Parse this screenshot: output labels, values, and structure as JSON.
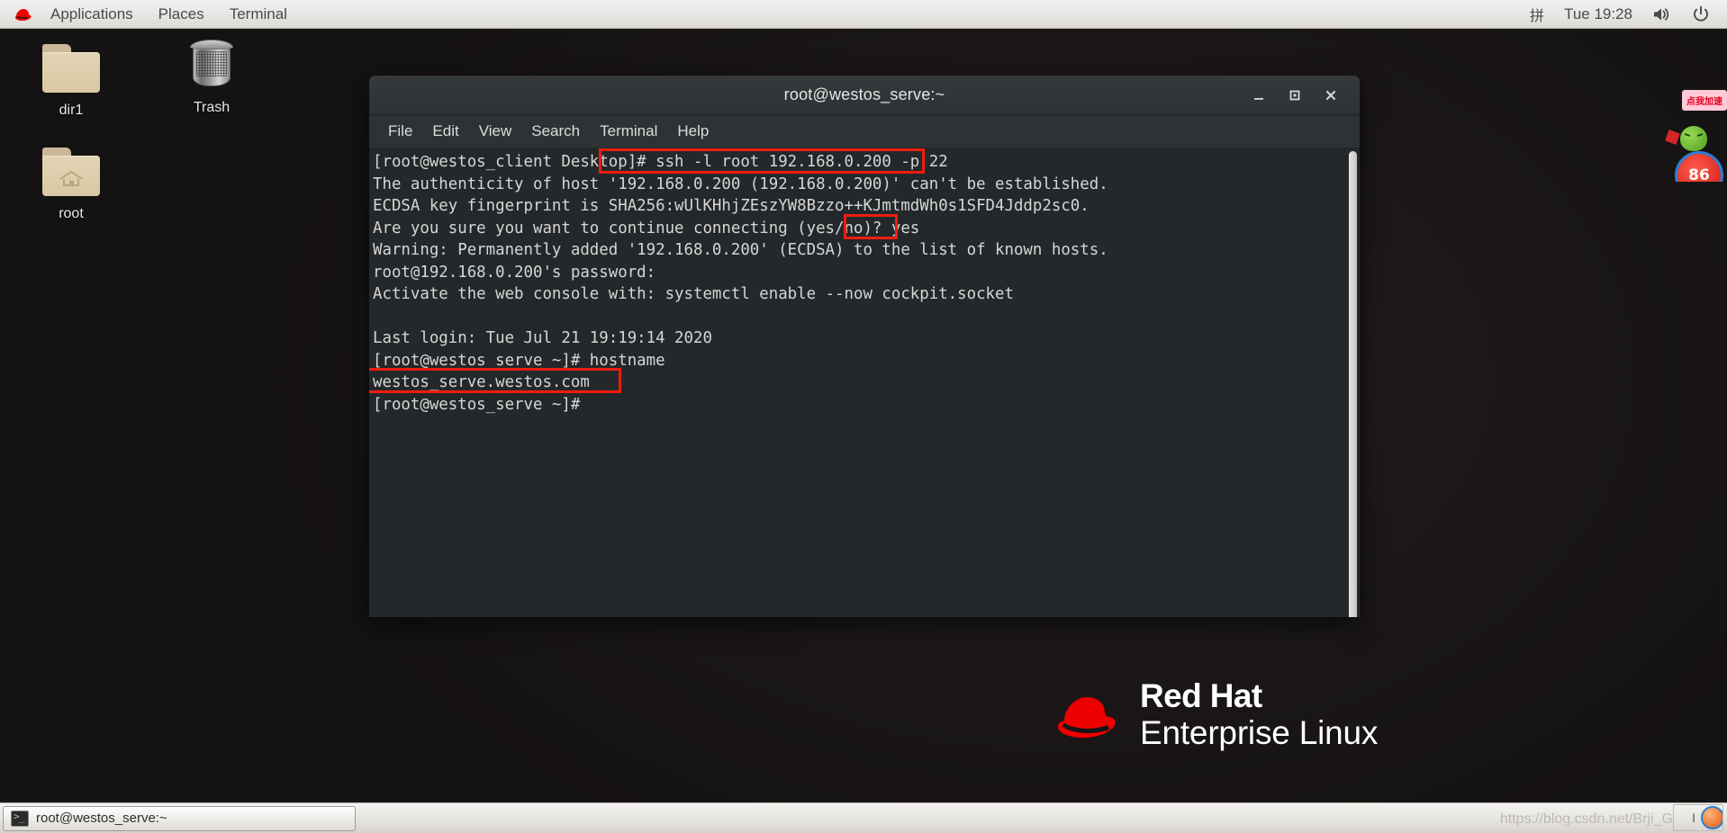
{
  "top_panel": {
    "redhat_icon": "redhat-logo-icon",
    "items": [
      {
        "label": "Applications"
      },
      {
        "label": "Places"
      },
      {
        "label": "Terminal"
      }
    ],
    "tray": {
      "ime": "拼",
      "clock": "Tue 19:28",
      "volume_icon": "volume-icon",
      "power_icon": "power-icon"
    }
  },
  "desktop": {
    "icons": [
      {
        "label": "dir1",
        "icon": "folder-icon"
      },
      {
        "label": "Trash",
        "icon": "trash-icon"
      },
      {
        "label": "root",
        "icon": "home-folder-icon"
      }
    ],
    "branding": {
      "line1": "Red Hat",
      "line2": "Enterprise Linux",
      "hat_icon": "redhat-fedora-icon",
      "hat_color": "#ee0000"
    },
    "ad_widget": {
      "bubble_text": "点我加速",
      "badge_text": "86"
    }
  },
  "terminal": {
    "title": "root@westos_serve:~",
    "window_controls": {
      "minimize": "minimize-icon",
      "maximize": "maximize-icon",
      "close": "close-icon"
    },
    "menu": [
      {
        "label": "File"
      },
      {
        "label": "Edit"
      },
      {
        "label": "View"
      },
      {
        "label": "Search"
      },
      {
        "label": "Terminal"
      },
      {
        "label": "Help"
      }
    ],
    "content": "[root@westos_client Desktop]# ssh -l root 192.168.0.200 -p 22\nThe authenticity of host '192.168.0.200 (192.168.0.200)' can't be established.\nECDSA key fingerprint is SHA256:wUlKHhjZEszYW8Bzzo++KJmtmdWh0s1SFD4Jddp2sc0.\nAre you sure you want to continue connecting (yes/no)? yes\nWarning: Permanently added '192.168.0.200' (ECDSA) to the list of known hosts.\nroot@192.168.0.200's password:\nActivate the web console with: systemctl enable --now cockpit.socket\n\nLast login: Tue Jul 21 19:19:14 2020\n[root@westos_serve ~]# hostname\nwestos_serve.westos.com\n[root@westos_serve ~]#",
    "highlight_color": "#f01c0e",
    "highlights": [
      {
        "name": "ssh-command",
        "text": "ssh -l root 192.168.0.200 -p 22"
      },
      {
        "name": "yes-answer",
        "text": "yes"
      },
      {
        "name": "hostname-output",
        "text": "westos_serve.westos.com"
      }
    ],
    "scrollbar": "vertical-scrollbar"
  },
  "taskbar": {
    "window_button": {
      "label": "root@westos_serve:~",
      "icon": "terminal-icon"
    },
    "watermark": "https://blog.csdn.net/Brji_G"
  }
}
